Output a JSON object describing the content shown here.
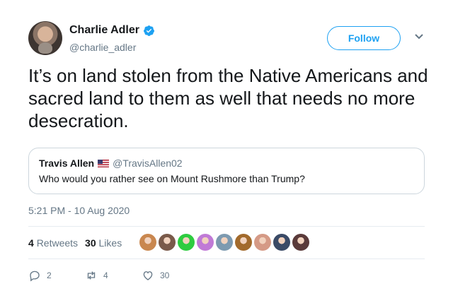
{
  "author": {
    "display_name": "Charlie Adler",
    "handle": "@charlie_adler",
    "verified": true,
    "avatar_icon": "user-avatar"
  },
  "follow_button": {
    "label": "Follow"
  },
  "menu_icon": "chevron-down-icon",
  "tweet": {
    "text": "It’s on land stolen from the Native Americans and sacred land to them as well that needs no more desecration.",
    "timestamp": "5:21 PM - 10 Aug 2020"
  },
  "quoted_tweet": {
    "display_name": "Travis Allen",
    "flag_icon": "us-flag-icon",
    "handle": "@TravisAllen02",
    "text": "Who would you rather see on Mount Rushmore than Trump?"
  },
  "stats": {
    "retweets_count": "4",
    "retweets_label": "Retweets",
    "likes_count": "30",
    "likes_label": "Likes"
  },
  "likers": [
    {
      "icon": "liker-avatar",
      "color": "#c9874f"
    },
    {
      "icon": "liker-avatar",
      "color": "#7a5a4a"
    },
    {
      "icon": "liker-avatar",
      "color": "#2ecc40"
    },
    {
      "icon": "liker-avatar",
      "color": "#c07ad6"
    },
    {
      "icon": "liker-avatar",
      "color": "#7d9ab0"
    },
    {
      "icon": "liker-avatar",
      "color": "#a26a2c"
    },
    {
      "icon": "liker-avatar",
      "color": "#d59a86"
    },
    {
      "icon": "liker-avatar",
      "color": "#3a4a66"
    },
    {
      "icon": "liker-avatar",
      "color": "#5a3a3a"
    }
  ],
  "actions": {
    "reply_count": "2",
    "retweet_count": "4",
    "like_count": "30"
  },
  "colors": {
    "accent": "#1da1f2",
    "secondary_text": "#657786",
    "border": "#ccd6dd"
  }
}
